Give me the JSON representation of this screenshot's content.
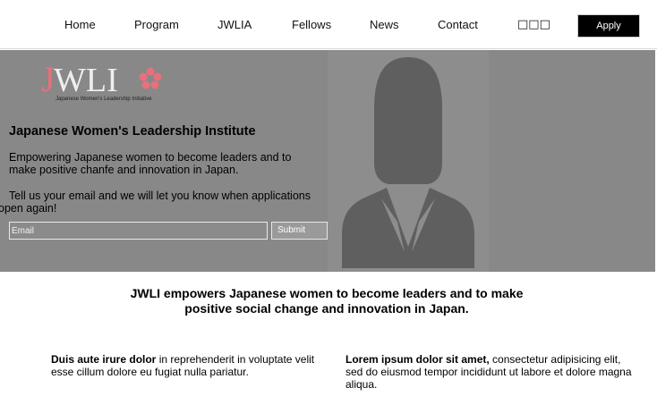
{
  "nav": {
    "items": [
      "Home",
      "Program",
      "JWLIA",
      "Fellows",
      "News",
      "Contact"
    ],
    "language_label": "□□□",
    "apply_label": "Apply"
  },
  "hero": {
    "logo": {
      "wordmark": "JWLI",
      "tagline": "Japanese Women's Leadership Initiative",
      "accent_color": "#e8707c"
    },
    "title": "Japanese Women's Leadership Institute",
    "description": "Empowering Japanese women to become leaders and to make positive chanfe and innovation in Japan.",
    "email_prompt": "Tell us your email and we will let you know when applications open again!",
    "email_placeholder": "Email",
    "submit_label": "Submit",
    "background_color": "#888888",
    "image_icon": "woman-silhouette-icon"
  },
  "mission": {
    "text": "JWLI empowers Japanese women to become leaders and to make positive social change and innovation in Japan."
  },
  "columns": {
    "left": {
      "bold": "Duis aute irure dolor",
      "rest": " in reprehenderit in voluptate velit esse cillum dolore eu fugiat nulla pariatur."
    },
    "right": {
      "bold": "Lorem ipsum dolor sit amet,",
      "rest": " consectetur adipisicing elit, sed do eiusmod tempor incididunt ut labore et dolore magna aliqua."
    }
  }
}
